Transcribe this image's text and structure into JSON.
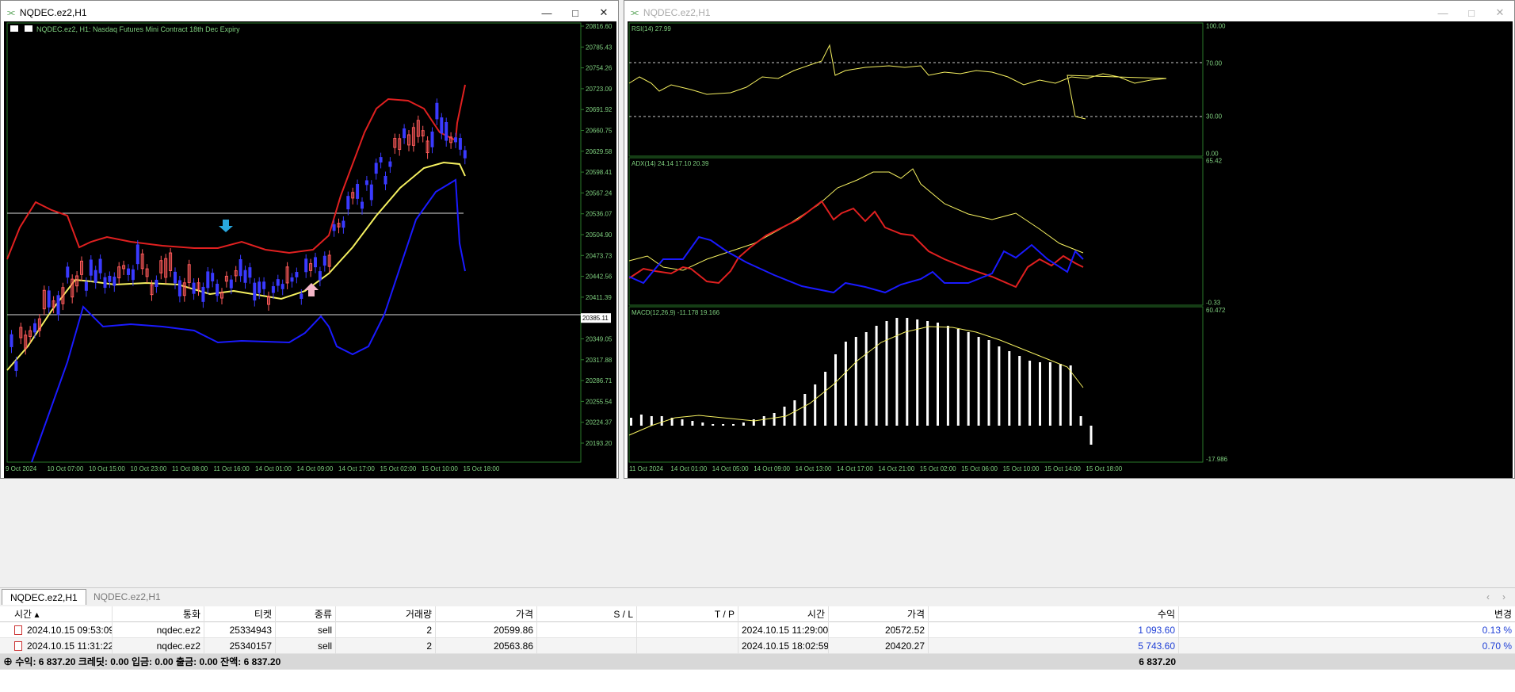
{
  "left_window": {
    "title": "NQDEC.ez2,H1",
    "chart_header": "NQDEC.ez2, H1:  Nasdaq Futures Mini Contract 18th Dec Expiry",
    "price_labels": [
      "20816.60",
      "20785.43",
      "20754.26",
      "20723.09",
      "20691.92",
      "20660.75",
      "20629.58",
      "20598.41",
      "20567.24",
      "20536.07",
      "20504.90",
      "20473.73",
      "20442.56",
      "20411.39",
      "20385.11",
      "20349.05",
      "20317.88",
      "20286.71",
      "20255.54",
      "20224.37",
      "20193.20"
    ],
    "current_price": "20385.11",
    "time_labels": [
      "9 Oct 2024",
      "10 Oct 07:00",
      "10 Oct 15:00",
      "10 Oct 23:00",
      "11 Oct 08:00",
      "11 Oct 16:00",
      "14 Oct 01:00",
      "14 Oct 09:00",
      "14 Oct 17:00",
      "15 Oct 02:00",
      "15 Oct 10:00",
      "15 Oct 18:00"
    ],
    "colors": {
      "upper_band": "#e02020",
      "middle_band": "#f5f060",
      "lower_band": "#1a1aff",
      "down_arrow": "#29a8e0",
      "up_arrow": "#f4b6c8",
      "candle_up": "#ff5a5a",
      "candle_down": "#3a3aff"
    }
  },
  "right_window": {
    "title": "NQDEC.ez2,H1",
    "rsi": {
      "label": "RSI(14) 27.99",
      "levels": [
        "100.00",
        "70.00",
        "30.00",
        "0.00"
      ]
    },
    "adx": {
      "label": "ADX(14) 24.14 17.10 20.39",
      "levels": [
        "65.42",
        "-0.33"
      ]
    },
    "macd": {
      "label": "MACD(12,26,9) -11.178 19.166",
      "levels": [
        "60.472",
        "-17.986"
      ]
    },
    "time_labels": [
      "11 Oct 2024",
      "14 Oct 01:00",
      "14 Oct 05:00",
      "14 Oct 09:00",
      "14 Oct 13:00",
      "14 Oct 17:00",
      "14 Oct 21:00",
      "15 Oct 02:00",
      "15 Oct 06:00",
      "15 Oct 10:00",
      "15 Oct 14:00",
      "15 Oct 18:00"
    ]
  },
  "tabs": [
    {
      "label": "NQDEC.ez2,H1",
      "active": true
    },
    {
      "label": "NQDEC.ez2,H1",
      "active": false
    }
  ],
  "trade_table": {
    "headers": {
      "time": "시간",
      "symbol": "통화",
      "ticket": "티켓",
      "type": "종류",
      "volume": "거래량",
      "price": "가격",
      "sl": "S / L",
      "tp": "T / P",
      "close_time": "시간",
      "close_price": "가격",
      "profit": "수익",
      "change": "변경"
    },
    "rows": [
      {
        "time": "2024.10.15 09:53:09",
        "symbol": "nqdec.ez2",
        "ticket": "25334943",
        "type": "sell",
        "volume": "2",
        "price": "20599.86",
        "close_time": "2024.10.15 11:29:00",
        "close_price": "20572.52",
        "profit": "1 093.60",
        "change": "0.13 %"
      },
      {
        "time": "2024.10.15 11:31:22",
        "symbol": "nqdec.ez2",
        "ticket": "25340157",
        "type": "sell",
        "volume": "2",
        "price": "20563.86",
        "close_time": "2024.10.15 18:02:59",
        "close_price": "20420.27",
        "profit": "5 743.60",
        "change": "0.70 %"
      }
    ],
    "summary": "수익: 6 837.20  크레딧: 0.00  입금: 0.00  출금: 0.00  잔액: 6 837.20",
    "total_profit": "6 837.20"
  }
}
